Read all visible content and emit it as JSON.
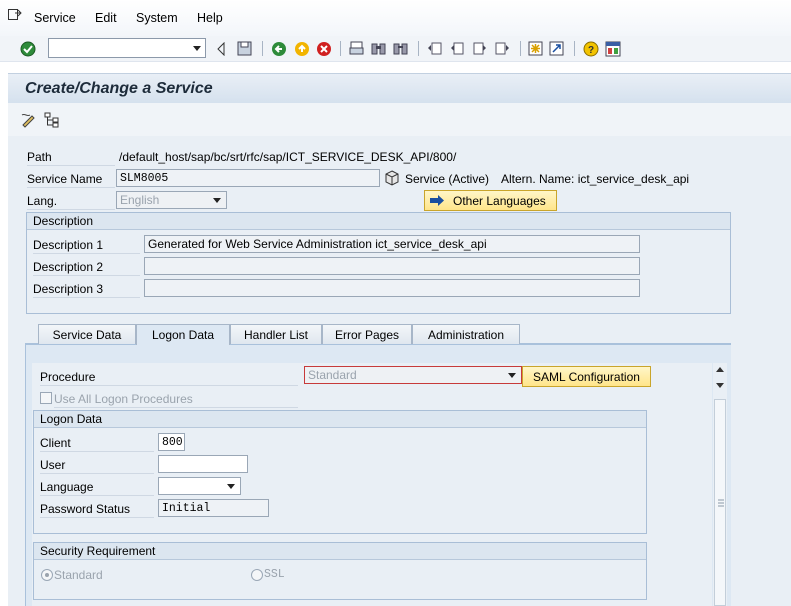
{
  "menu": {
    "items": [
      "Service",
      "Edit",
      "System",
      "Help"
    ]
  },
  "toolbar": {
    "command_field_value": ""
  },
  "title": "Create/Change a Service",
  "form": {
    "path_label": "Path",
    "path_value": "/default_host/sap/bc/srt/rfc/sap/ICT_SERVICE_DESK_API/800/",
    "service_name_label": "Service Name",
    "service_name_value": "SLM8005",
    "service_status": "Service (Active)",
    "altern_name": "Altern. Name: ict_service_desk_api",
    "lang_label": "Lang.",
    "lang_value": "English",
    "other_languages_button": "Other Languages"
  },
  "description": {
    "title": "Description",
    "rows": [
      {
        "label": "Description 1",
        "value": "Generated for Web Service Administration ict_service_desk_api"
      },
      {
        "label": "Description 2",
        "value": ""
      },
      {
        "label": "Description 3",
        "value": ""
      }
    ]
  },
  "tabs": [
    "Service Data",
    "Logon Data",
    "Handler List",
    "Error Pages",
    "Administration"
  ],
  "active_tab": "Logon Data",
  "logon": {
    "procedure_label": "Procedure",
    "procedure_value": "Standard",
    "saml_button": "SAML Configuration",
    "use_all_label": "Use All Logon Procedures",
    "logon_data_title": "Logon Data",
    "client_label": "Client",
    "client_value": "800",
    "user_label": "User",
    "user_value": "",
    "language_label": "Language",
    "language_value": "",
    "password_status_label": "Password Status",
    "password_status_value": "Initial",
    "security_title": "Security Requirement",
    "radio_standard": "Standard",
    "radio_ssl": "SSL",
    "selected_security": "Standard"
  },
  "colors": {
    "accent": "#1a4fa0",
    "button_yellow": "#ffe58a",
    "panel": "#e9eff5"
  }
}
